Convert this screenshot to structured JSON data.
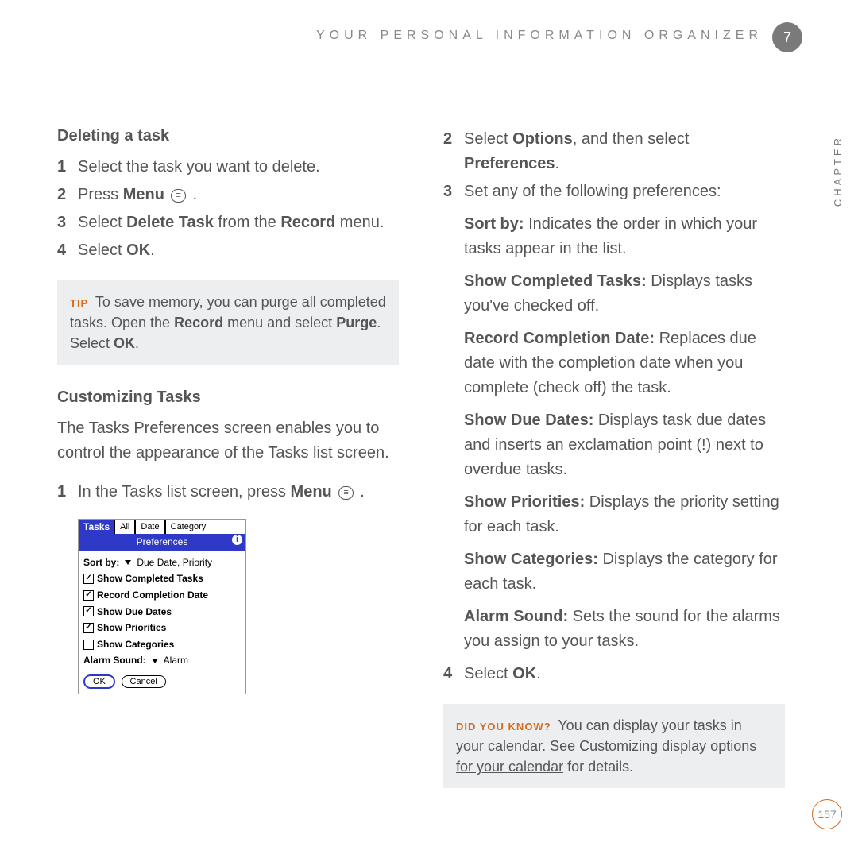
{
  "header": {
    "title": "YOUR PERSONAL INFORMATION ORGANIZER",
    "chapter_num": "7",
    "chapter_label": "CHAPTER"
  },
  "page_number": "157",
  "left": {
    "h_delete": "Deleting a task",
    "del_steps": [
      {
        "n": "1",
        "html": "Select the task you want to delete."
      },
      {
        "n": "2",
        "pre": "Press ",
        "b": "Menu",
        "icon": true,
        "post": " ."
      },
      {
        "n": "3",
        "pre": "Select ",
        "b": "Delete Task",
        "mid": " from the ",
        "b2": "Record",
        "post": " menu."
      },
      {
        "n": "4",
        "pre": "Select ",
        "b": "OK",
        "post": "."
      }
    ],
    "tip_label": "TIP",
    "tip_text_1": "To save memory, you can purge all completed tasks. Open the ",
    "tip_b1": "Record",
    "tip_text_2": " menu and select ",
    "tip_b2": "Purge",
    "tip_text_3": ". Select ",
    "tip_b3": "OK",
    "tip_text_4": ".",
    "h_custom": "Customizing Tasks",
    "custom_intro": "The Tasks Preferences screen enables you to control the appearance of the Tasks list screen.",
    "cus_step1_n": "1",
    "cus_step1_pre": "In the Tasks list screen, press ",
    "cus_step1_b": "Menu"
  },
  "palm": {
    "title": "Tasks",
    "tabs": [
      "All",
      "Date",
      "Category"
    ],
    "subtitle": "Preferences",
    "sortby_label": "Sort by:",
    "sortby_value": "Due Date, Priority",
    "rows": [
      {
        "checked": true,
        "label": "Show Completed Tasks"
      },
      {
        "checked": true,
        "label": "Record Completion Date"
      },
      {
        "checked": true,
        "label": "Show Due Dates"
      },
      {
        "checked": true,
        "label": "Show Priorities"
      },
      {
        "checked": false,
        "label": "Show Categories"
      }
    ],
    "alarm_label": "Alarm Sound:",
    "alarm_value": "Alarm",
    "ok": "OK",
    "cancel": "Cancel"
  },
  "right": {
    "step2_n": "2",
    "step2_pre": "Select ",
    "step2_b1": "Options",
    "step2_mid": ", and then select ",
    "step2_b2": "Preferences",
    "step2_post": ".",
    "step3_n": "3",
    "step3_text": "Set any of the following preferences:",
    "prefs": [
      {
        "b": "Sort by:",
        "t": " Indicates the order in which your tasks appear in the list."
      },
      {
        "b": "Show Completed Tasks:",
        "t": " Displays tasks you've checked off."
      },
      {
        "b": "Record Completion Date:",
        "t": " Replaces due date with the completion date when you complete (check off) the task."
      },
      {
        "b": "Show Due Dates:",
        "t": " Displays task due dates and inserts an exclamation point (!) next to overdue tasks."
      },
      {
        "b": "Show Priorities:",
        "t": " Displays the priority setting for each task."
      },
      {
        "b": "Show Categories:",
        "t": " Displays the category for each task."
      },
      {
        "b": "Alarm Sound:",
        "t": " Sets the sound for the alarms you assign to your tasks."
      }
    ],
    "step4_n": "4",
    "step4_pre": "Select ",
    "step4_b": "OK",
    "step4_post": ".",
    "dyk_label": "DID YOU KNOW?",
    "dyk_1": " You can display your tasks in your calendar. See ",
    "dyk_link": "Customizing display options for your calendar",
    "dyk_2": " for details."
  }
}
